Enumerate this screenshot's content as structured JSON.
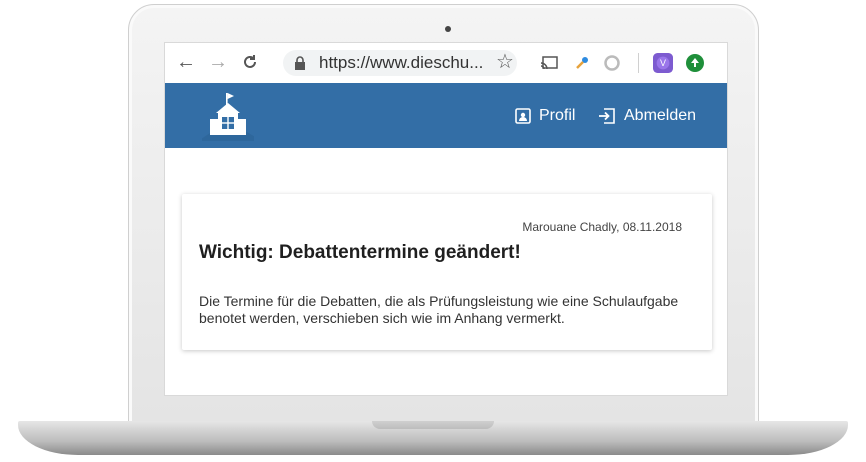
{
  "browser": {
    "url_display": "https://www.dieschu...",
    "icons": [
      "back-icon",
      "forward-icon",
      "reload-icon",
      "lock-icon",
      "bookmark-star-icon",
      "cast-icon",
      "key-icon",
      "extension-icon",
      "profile-avatar-icon",
      "extension-green-icon"
    ],
    "profile_initial": "V"
  },
  "app": {
    "header_color": "#336ea6",
    "nav": {
      "profile_label": "Profil",
      "logout_label": "Abmelden"
    }
  },
  "announcement": {
    "meta": "Marouane Chadly, 08.11.2018",
    "title": "Wichtig: Debattentermine geändert!",
    "body": "Die Termine für die Debatten, die als Prüfungsleistung wie eine Schulaufgabe benotet werden, verschieben sich wie im Anhang vermerkt."
  }
}
